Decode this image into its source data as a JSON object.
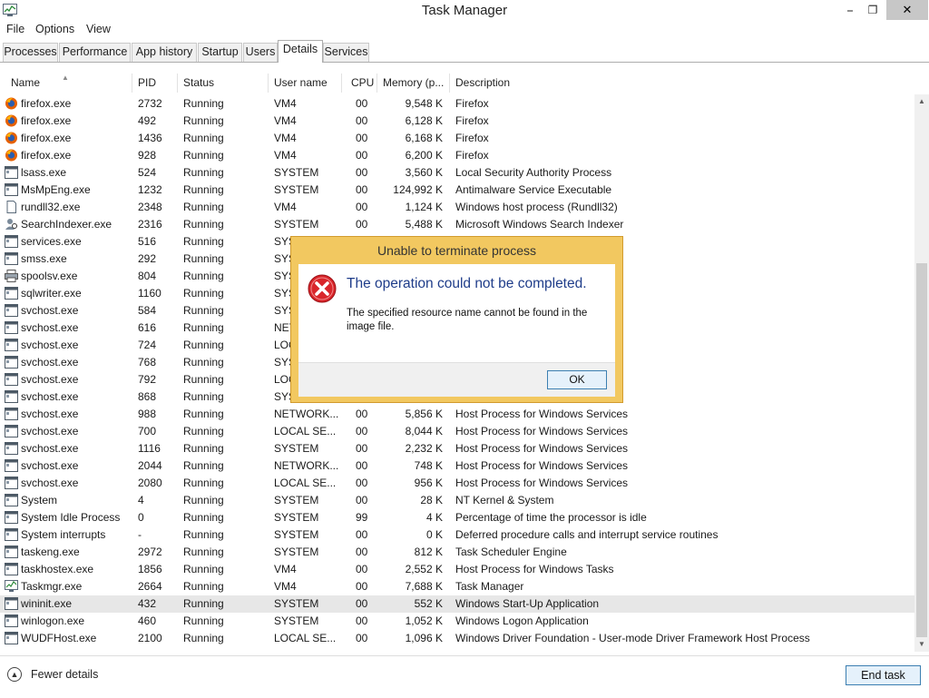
{
  "window": {
    "title": "Task Manager",
    "minimize": "⎯",
    "maximize": "❐",
    "close": "✕"
  },
  "menu": [
    "File",
    "Options",
    "View"
  ],
  "tabs": [
    "Processes",
    "Performance",
    "App history",
    "Startup",
    "Users",
    "Details",
    "Services"
  ],
  "active_tab": "Details",
  "columns": [
    "Name",
    "PID",
    "Status",
    "User name",
    "CPU",
    "Memory (p...",
    "Description"
  ],
  "rows": [
    {
      "name": "firefox.exe",
      "pid": "2732",
      "status": "Running",
      "user": "VM4",
      "cpu": "00",
      "mem": "9,548 K",
      "desc": "Firefox",
      "icon": "firefox-icon"
    },
    {
      "name": "firefox.exe",
      "pid": "492",
      "status": "Running",
      "user": "VM4",
      "cpu": "00",
      "mem": "6,128 K",
      "desc": "Firefox",
      "icon": "firefox-icon"
    },
    {
      "name": "firefox.exe",
      "pid": "1436",
      "status": "Running",
      "user": "VM4",
      "cpu": "00",
      "mem": "6,168 K",
      "desc": "Firefox",
      "icon": "firefox-icon"
    },
    {
      "name": "firefox.exe",
      "pid": "928",
      "status": "Running",
      "user": "VM4",
      "cpu": "00",
      "mem": "6,200 K",
      "desc": "Firefox",
      "icon": "firefox-icon"
    },
    {
      "name": "lsass.exe",
      "pid": "524",
      "status": "Running",
      "user": "SYSTEM",
      "cpu": "00",
      "mem": "3,560 K",
      "desc": "Local Security Authority Process",
      "icon": "process-icon"
    },
    {
      "name": "MsMpEng.exe",
      "pid": "1232",
      "status": "Running",
      "user": "SYSTEM",
      "cpu": "00",
      "mem": "124,992 K",
      "desc": "Antimalware Service Executable",
      "icon": "process-icon"
    },
    {
      "name": "rundll32.exe",
      "pid": "2348",
      "status": "Running",
      "user": "VM4",
      "cpu": "00",
      "mem": "1,124 K",
      "desc": "Windows host process (Rundll32)",
      "icon": "document-icon"
    },
    {
      "name": "SearchIndexer.exe",
      "pid": "2316",
      "status": "Running",
      "user": "SYSTEM",
      "cpu": "00",
      "mem": "5,488 K",
      "desc": "Microsoft Windows Search Indexer",
      "icon": "search-person-icon"
    },
    {
      "name": "services.exe",
      "pid": "516",
      "status": "Running",
      "user": "SYS",
      "cpu": "",
      "mem": "",
      "desc": "",
      "icon": "process-icon"
    },
    {
      "name": "smss.exe",
      "pid": "292",
      "status": "Running",
      "user": "SYS",
      "cpu": "",
      "mem": "",
      "desc": "",
      "icon": "process-icon"
    },
    {
      "name": "spoolsv.exe",
      "pid": "804",
      "status": "Running",
      "user": "SYS",
      "cpu": "",
      "mem": "",
      "desc": "",
      "icon": "printer-icon"
    },
    {
      "name": "sqlwriter.exe",
      "pid": "1160",
      "status": "Running",
      "user": "SYS",
      "cpu": "",
      "mem": "",
      "desc": "",
      "icon": "process-icon"
    },
    {
      "name": "svchost.exe",
      "pid": "584",
      "status": "Running",
      "user": "SYS",
      "cpu": "",
      "mem": "",
      "desc": "",
      "icon": "process-icon"
    },
    {
      "name": "svchost.exe",
      "pid": "616",
      "status": "Running",
      "user": "NET",
      "cpu": "",
      "mem": "",
      "desc": "",
      "icon": "process-icon"
    },
    {
      "name": "svchost.exe",
      "pid": "724",
      "status": "Running",
      "user": "LOC",
      "cpu": "",
      "mem": "",
      "desc": "",
      "icon": "process-icon"
    },
    {
      "name": "svchost.exe",
      "pid": "768",
      "status": "Running",
      "user": "SYS",
      "cpu": "",
      "mem": "",
      "desc": "",
      "icon": "process-icon"
    },
    {
      "name": "svchost.exe",
      "pid": "792",
      "status": "Running",
      "user": "LOC",
      "cpu": "",
      "mem": "",
      "desc": "",
      "icon": "process-icon"
    },
    {
      "name": "svchost.exe",
      "pid": "868",
      "status": "Running",
      "user": "SYS",
      "cpu": "",
      "mem": "",
      "desc": "",
      "icon": "process-icon"
    },
    {
      "name": "svchost.exe",
      "pid": "988",
      "status": "Running",
      "user": "NETWORK...",
      "cpu": "00",
      "mem": "5,856 K",
      "desc": "Host Process for Windows Services",
      "icon": "process-icon"
    },
    {
      "name": "svchost.exe",
      "pid": "700",
      "status": "Running",
      "user": "LOCAL SE...",
      "cpu": "00",
      "mem": "8,044 K",
      "desc": "Host Process for Windows Services",
      "icon": "process-icon"
    },
    {
      "name": "svchost.exe",
      "pid": "1116",
      "status": "Running",
      "user": "SYSTEM",
      "cpu": "00",
      "mem": "2,232 K",
      "desc": "Host Process for Windows Services",
      "icon": "process-icon"
    },
    {
      "name": "svchost.exe",
      "pid": "2044",
      "status": "Running",
      "user": "NETWORK...",
      "cpu": "00",
      "mem": "748 K",
      "desc": "Host Process for Windows Services",
      "icon": "process-icon"
    },
    {
      "name": "svchost.exe",
      "pid": "2080",
      "status": "Running",
      "user": "LOCAL SE...",
      "cpu": "00",
      "mem": "956 K",
      "desc": "Host Process for Windows Services",
      "icon": "process-icon"
    },
    {
      "name": "System",
      "pid": "4",
      "status": "Running",
      "user": "SYSTEM",
      "cpu": "00",
      "mem": "28 K",
      "desc": "NT Kernel & System",
      "icon": "process-icon"
    },
    {
      "name": "System Idle Process",
      "pid": "0",
      "status": "Running",
      "user": "SYSTEM",
      "cpu": "99",
      "mem": "4 K",
      "desc": "Percentage of time the processor is idle",
      "icon": "process-icon"
    },
    {
      "name": "System interrupts",
      "pid": "-",
      "status": "Running",
      "user": "SYSTEM",
      "cpu": "00",
      "mem": "0 K",
      "desc": "Deferred procedure calls and interrupt service routines",
      "icon": "process-icon"
    },
    {
      "name": "taskeng.exe",
      "pid": "2972",
      "status": "Running",
      "user": "SYSTEM",
      "cpu": "00",
      "mem": "812 K",
      "desc": "Task Scheduler Engine",
      "icon": "process-icon"
    },
    {
      "name": "taskhostex.exe",
      "pid": "1856",
      "status": "Running",
      "user": "VM4",
      "cpu": "00",
      "mem": "2,552 K",
      "desc": "Host Process for Windows Tasks",
      "icon": "process-icon"
    },
    {
      "name": "Taskmgr.exe",
      "pid": "2664",
      "status": "Running",
      "user": "VM4",
      "cpu": "00",
      "mem": "7,688 K",
      "desc": "Task Manager",
      "icon": "taskmgr-icon"
    },
    {
      "name": "wininit.exe",
      "pid": "432",
      "status": "Running",
      "user": "SYSTEM",
      "cpu": "00",
      "mem": "552 K",
      "desc": "Windows Start-Up Application",
      "icon": "process-icon",
      "selected": true
    },
    {
      "name": "winlogon.exe",
      "pid": "460",
      "status": "Running",
      "user": "SYSTEM",
      "cpu": "00",
      "mem": "1,052 K",
      "desc": "Windows Logon Application",
      "icon": "process-icon"
    },
    {
      "name": "WUDFHost.exe",
      "pid": "2100",
      "status": "Running",
      "user": "LOCAL SE...",
      "cpu": "00",
      "mem": "1,096 K",
      "desc": "Windows Driver Foundation - User-mode Driver Framework Host Process",
      "icon": "process-icon"
    }
  ],
  "footer": {
    "fewer_details": "Fewer details",
    "end_task": "End task"
  },
  "dialog": {
    "title": "Unable to terminate process",
    "main": "The operation could not be completed.",
    "detail": "The specified resource name cannot be found in the image file.",
    "ok": "OK",
    "icon": "error-icon"
  },
  "colors": {
    "dialog_frame": "#f2c860",
    "dialog_heading": "#1f3d8a",
    "selected_row": "#e7e7e7",
    "button_border": "#3c7fb1"
  }
}
